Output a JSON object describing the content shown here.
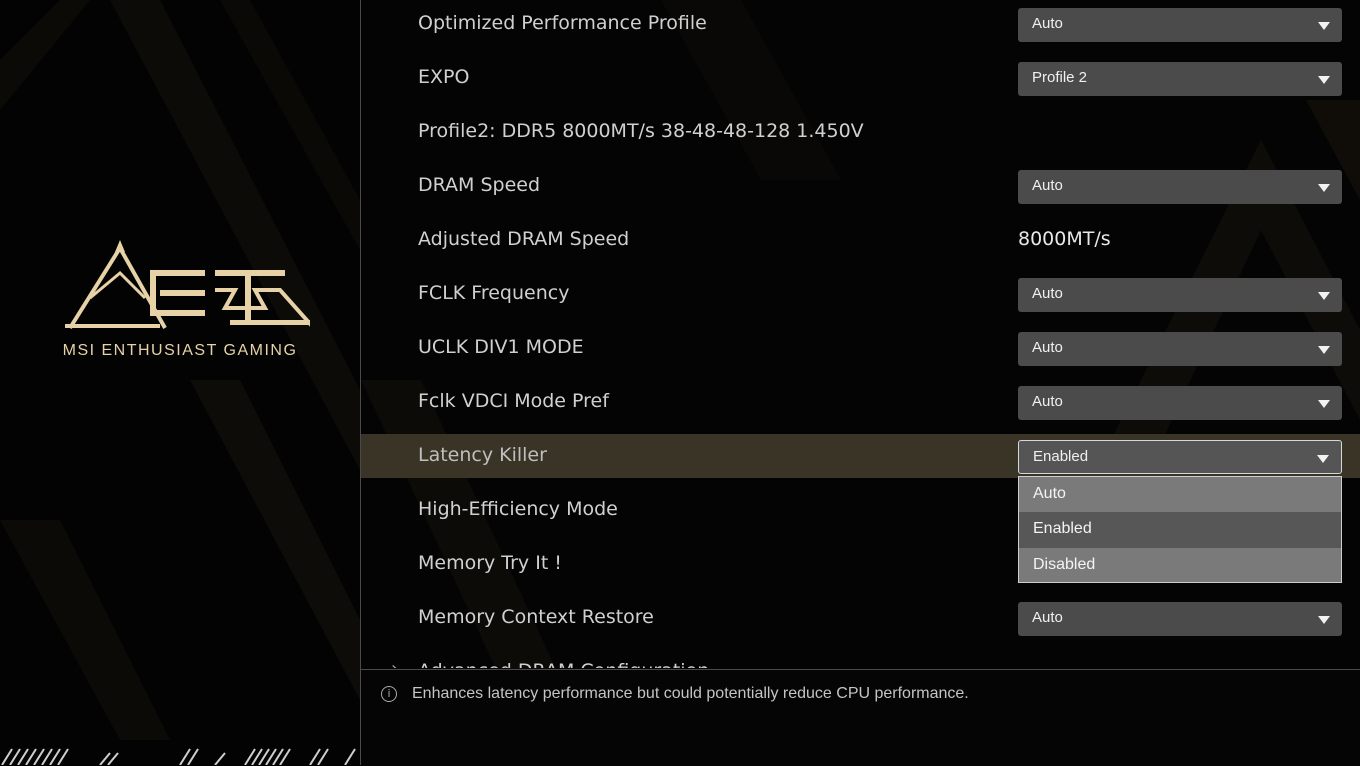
{
  "brand": {
    "name": "MSI ENTHUSIAST GAMING",
    "logo_icon": "meg-logo-icon"
  },
  "settings": [
    {
      "label": "Optimized Performance Profile",
      "type": "dropdown",
      "value": "Auto"
    },
    {
      "label": "EXPO",
      "type": "dropdown",
      "value": "Profile 2"
    },
    {
      "label": "Profile2: DDR5 8000MT/s 38-48-48-128 1.450V",
      "type": "info",
      "value": ""
    },
    {
      "label": "DRAM Speed",
      "type": "dropdown",
      "value": "Auto"
    },
    {
      "label": "Adjusted DRAM Speed",
      "type": "readonly",
      "value": "8000MT/s"
    },
    {
      "label": "FCLK Frequency",
      "type": "dropdown",
      "value": "Auto"
    },
    {
      "label": "UCLK DIV1 MODE",
      "type": "dropdown",
      "value": "Auto"
    },
    {
      "label": "Fclk VDCI Mode Pref",
      "type": "dropdown",
      "value": "Auto"
    },
    {
      "label": "Latency Killer",
      "type": "dropdown",
      "value": "Enabled",
      "selected": true
    },
    {
      "label": "High-Efficiency Mode",
      "type": "dropdown-hidden",
      "value": ""
    },
    {
      "label": "Memory Try It !",
      "type": "dropdown-hidden",
      "value": ""
    },
    {
      "label": "Memory Context Restore",
      "type": "dropdown",
      "value": "Auto"
    },
    {
      "label": "Advanced DRAM Configuration",
      "type": "submenu",
      "value": ""
    }
  ],
  "popup": {
    "options": [
      "Auto",
      "Enabled",
      "Disabled"
    ],
    "selected_index": 1
  },
  "help": {
    "icon": "info-icon",
    "text": "Enhances latency performance but could potentially reduce CPU performance."
  },
  "colors": {
    "accent": "#e6d2a6",
    "highlight_row": "#3a3427",
    "dropdown_bg": "#4b4b4b"
  }
}
